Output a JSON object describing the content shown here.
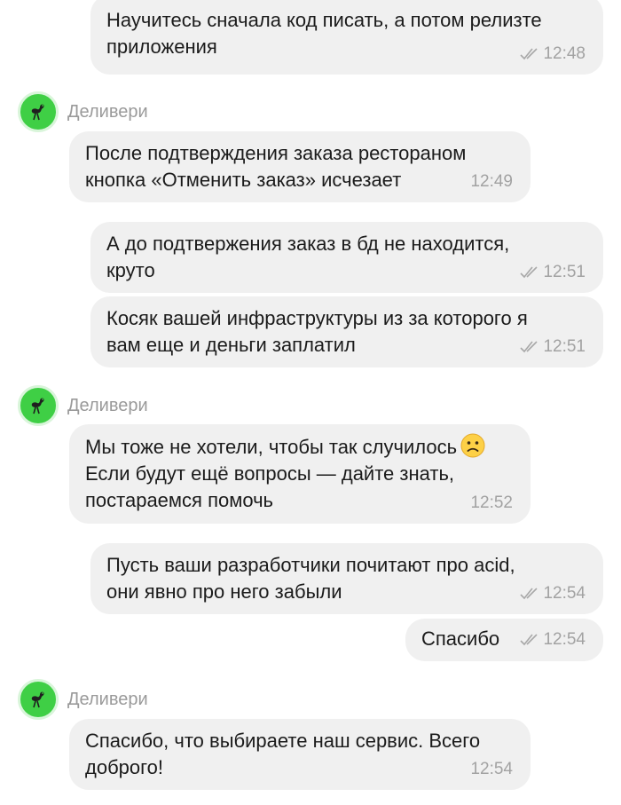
{
  "messages": [
    {
      "text": "Научитесь сначала код писать, а потом релизте\nприложения",
      "time": "12:48"
    },
    {
      "text": "После подтверждения заказа рестораном\nкнопка «Отменить заказ» исчезает",
      "time": "12:49"
    },
    {
      "text": "А до подтвержения заказ в бд не находится,\nкруто",
      "time": "12:51"
    },
    {
      "text": "Косяк вашей инфраструктуры из за которого я\nвам еще и деньги заплатил",
      "time": "12:51"
    },
    {
      "text_line1": "Мы тоже не хотели, чтобы так случилось",
      "text_rest": "Если будут ещё вопросы — дайте знать,\nпостараемся помочь",
      "time": "12:52",
      "emoji": "slightly-frowning-face-emoji"
    },
    {
      "text": "Пусть ваши разработчики почитают про acid,\nони явно про него забыли",
      "time": "12:54"
    },
    {
      "text": "Спасибо",
      "time": "12:54"
    },
    {
      "text": "Спасибо, что выбираете наш сервис. Всего\nдоброго!",
      "time": "12:54"
    }
  ],
  "sender": {
    "name": "Деливери",
    "avatar_icon": "ostrich-icon",
    "avatar_color": "#3fcf45"
  },
  "colors": {
    "bubble": "#f0f0f0",
    "meta_text": "#a2a2a2",
    "sender_name": "#9a9a9a"
  }
}
